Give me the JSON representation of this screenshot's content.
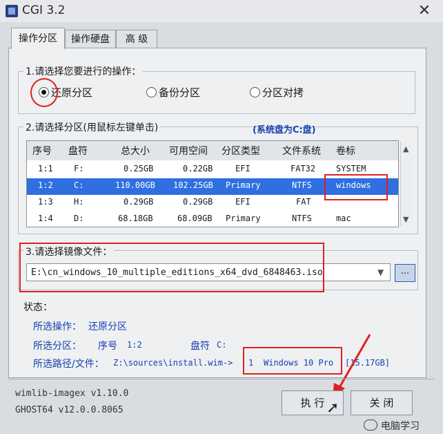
{
  "window": {
    "title": "CGI 3.2",
    "close": "✕"
  },
  "tabs": [
    "操作分区",
    "操作硬盘",
    "高 级"
  ],
  "op_group": {
    "title": "1.请选择您要进行的操作：",
    "options": [
      {
        "label": "还原分区",
        "selected": true
      },
      {
        "label": "备份分区",
        "selected": false
      },
      {
        "label": "分区对拷",
        "selected": false
      }
    ]
  },
  "part_group": {
    "title": "2.请选择分区(用鼠标左键单击)",
    "note": "(系统盘为C:盘)",
    "columns": [
      "序号",
      "盘符",
      "总大小",
      "可用空间",
      "分区类型",
      "文件系统",
      "卷标"
    ],
    "rows": [
      {
        "id": "1:1",
        "drive": "F:",
        "total": "0.25GB",
        "free": "0.22GB",
        "type": "EFI",
        "fs": "FAT32",
        "label": "SYSTEM",
        "selected": false
      },
      {
        "id": "1:2",
        "drive": "C:",
        "total": "110.00GB",
        "free": "102.25GB",
        "type": "Primary",
        "fs": "NTFS",
        "label": "windows",
        "selected": true
      },
      {
        "id": "1:3",
        "drive": "H:",
        "total": "0.29GB",
        "free": "0.29GB",
        "type": "EFI",
        "fs": "FAT",
        "label": "",
        "selected": false
      },
      {
        "id": "1:4",
        "drive": "D:",
        "total": "68.18GB",
        "free": "68.09GB",
        "type": "Primary",
        "fs": "NTFS",
        "label": "mac",
        "selected": false
      }
    ]
  },
  "image_group": {
    "title": "3.请选择镜像文件：",
    "value": "E:\\cn_windows_10_multiple_editions_x64_dvd_6848463.iso",
    "browse": "..."
  },
  "status": {
    "title": "状态：",
    "op_label": "所选操作：",
    "op_value": "还原分区",
    "part_label": "所选分区：",
    "part_id_label": "序号",
    "part_id": "1:2",
    "drive_label": "盘符",
    "drive_value": "C:",
    "path_label": "所选路径/文件：",
    "path_value": "Z:\\sources\\install.wim->",
    "image_index": "1",
    "image_name": "Windows 10 Pro",
    "image_size": "[15.17GB]"
  },
  "footer": {
    "line1": "wimlib-imagex v1.10.0",
    "line2": "GHOST64 v12.0.0.8065"
  },
  "buttons": {
    "execute": "执 行",
    "close": "关 闭"
  },
  "watermark": "电脑学习",
  "colors": {
    "selection": "#2f6fe0",
    "highlight": "#e02020",
    "status_text": "#1640b0"
  }
}
